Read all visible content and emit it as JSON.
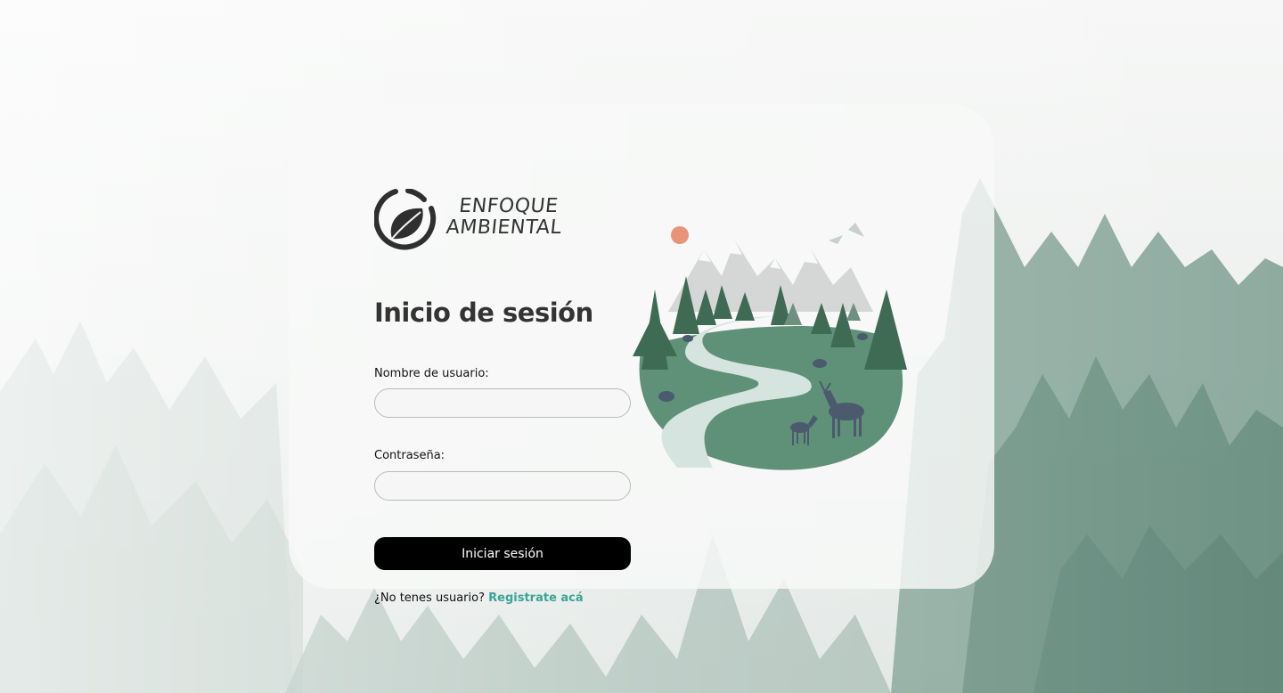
{
  "brand": {
    "line1": "ENFOQUE",
    "line2": "AMBIENTAL"
  },
  "login": {
    "title": "Inicio de sesión",
    "username_label": "Nombre de usuario:",
    "username_value": "",
    "password_label": "Contraseña:",
    "password_value": "",
    "submit_label": "Iniciar sesión",
    "register_prompt": "¿No tenes usuario?",
    "register_link": "Registrate acá"
  },
  "colors": {
    "accent": "#3aa596",
    "button": "#000000",
    "forest": "#5f9178",
    "text": "#333333"
  },
  "icons": {
    "logo": "leaf-circle-logo",
    "illustration": "forest-river-deer-illustration"
  }
}
